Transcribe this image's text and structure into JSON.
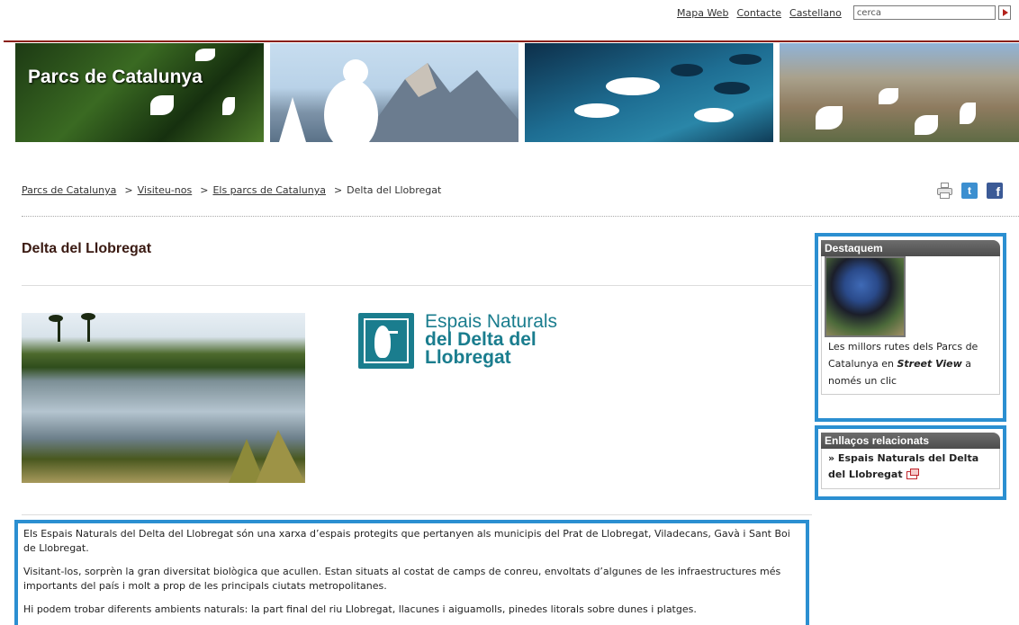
{
  "topbar": {
    "links": [
      "Mapa Web",
      "Contacte",
      "Castellano"
    ],
    "search_value": "cerca"
  },
  "banner": {
    "title": "Parcs de Catalunya"
  },
  "breadcrumb": {
    "items": [
      "Parcs de Catalunya",
      "Visiteu-nos",
      "Els parcs de Catalunya",
      "Delta del Llobregat"
    ],
    "separator": ">"
  },
  "share": {
    "icons": [
      "print-icon",
      "twitter-icon",
      "facebook-icon"
    ],
    "twitter_glyph": "t",
    "facebook_glyph": "f"
  },
  "page": {
    "title": "Delta del Llobregat"
  },
  "logo": {
    "line1": "Espais Naturals",
    "line2": "del Delta del",
    "line3": "Llobregat",
    "color": "#1a7d8e"
  },
  "body": {
    "paragraphs": [
      "Els Espais Naturals del Delta del Llobregat són una xarxa d’espais protegits que pertanyen als municipis del Prat de Llobregat, Viladecans, Gavà i Sant Boi de Llobregat.",
      "Visitant-los, sorprèn la gran diversitat biològica que acullen. Estan situats al costat de camps de conreu, envoltats d’algunes de les infraestructures més importants del país i molt a prop de les principals ciutats metropolitanes.",
      "Hi podem trobar diferents ambients naturals: la part final del riu Llobregat, llacunes i aiguamolls, pinedes litorals sobre dunes i platges."
    ]
  },
  "sidebar": {
    "featured": {
      "heading": "Destaquem",
      "text_before": "Les millors rutes dels Parcs de Catalunya en ",
      "emphasis": "Street View",
      "text_after": " a només un clic"
    },
    "related": {
      "heading": "Enllaços relacionats",
      "link": "» Espais Naturals del Delta del Llobregat"
    }
  },
  "colors": {
    "accent_blue": "#2b8fd1",
    "header_rule": "#8a1f15",
    "heading": "#3a1a12"
  }
}
